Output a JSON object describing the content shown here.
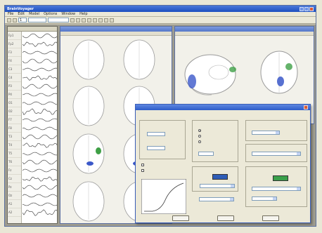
{
  "app": {
    "title": "BrainVoyager",
    "accent": "#2d5cc8"
  },
  "menu": {
    "items": [
      "File",
      "Edit",
      "Model",
      "Options",
      "Window",
      "Help"
    ]
  },
  "toolbar": {
    "field_1": "1",
    "field_2": "",
    "field_3": ""
  },
  "eeg": {
    "channels": [
      "Fp1",
      "Fp2",
      "F3",
      "F4",
      "C3",
      "C4",
      "P3",
      "P4",
      "O1",
      "O2",
      "F7",
      "F8",
      "T3",
      "T4",
      "T5",
      "T6",
      "Fz",
      "Cz",
      "Pz",
      "Oz",
      "A1",
      "A2"
    ]
  },
  "slices_window": {
    "title": "",
    "tab_text": ""
  },
  "glass_window": {
    "title": "",
    "tab_text": ""
  },
  "dialog": {
    "title": "",
    "tabs_text": "",
    "group_labels": [
      "",
      "",
      "",
      "",
      "",
      ""
    ],
    "fields": {
      "f1": "",
      "f2": "",
      "f3": "",
      "f4": "",
      "f5": "",
      "f6": "",
      "f7": ""
    },
    "colors": {
      "positive": "#2e5db7",
      "negative": "#3aa04a",
      "curve_bg": "#ffffff"
    },
    "buttons": {
      "ok": "",
      "cancel": "",
      "help": ""
    }
  },
  "colors": {
    "activation_blue": "#3b58c9",
    "activation_green": "#3fa046",
    "brain_fill": "#ffffff",
    "workspace": "#9e9c8f"
  }
}
